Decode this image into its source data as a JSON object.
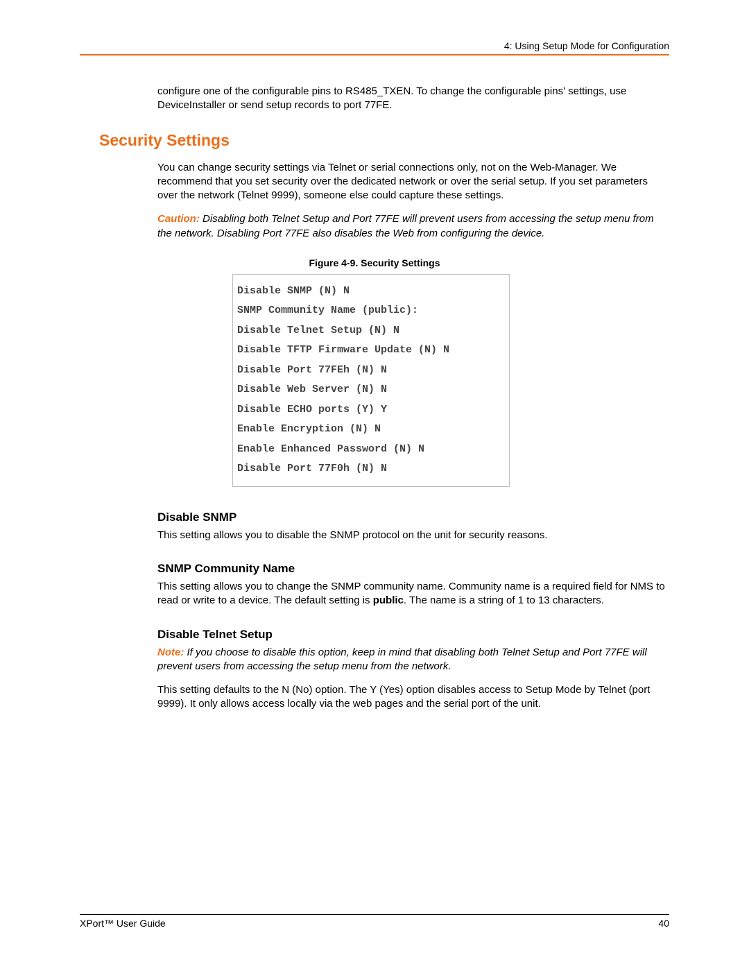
{
  "header": {
    "chapter": "4: Using Setup Mode for Configuration"
  },
  "intro_paragraph": "configure one of the configurable pins to RS485_TXEN.  To change the configurable pins' settings, use DeviceInstaller or send setup records to port 77FE.",
  "section_heading": "Security Settings",
  "security_intro": "You can change security settings via Telnet or serial connections only, not on the Web-Manager. We recommend that you set security over the dedicated network or over the serial setup. If you set parameters over the network (Telnet 9999), someone else could capture these settings.",
  "caution": {
    "label": "Caution:",
    "text": " Disabling both Telnet Setup and Port 77FE will prevent users from accessing the setup menu from the network. Disabling Port 77FE also disables the Web from configuring the device."
  },
  "figure": {
    "caption": "Figure 4-9. Security Settings",
    "lines": [
      "Disable SNMP (N) N",
      "SNMP Community Name (public):",
      "Disable Telnet Setup (N) N",
      "Disable TFTP Firmware Update (N) N",
      "Disable Port 77FEh (N) N",
      "Disable Web Server (N) N",
      "Disable ECHO ports (Y) Y",
      "Enable Encryption (N) N",
      "Enable Enhanced Password (N) N",
      "Disable Port 77F0h (N) N"
    ]
  },
  "sub1": {
    "heading": "Disable SNMP",
    "text": "This setting allows you to disable the SNMP protocol on the unit for security reasons."
  },
  "sub2": {
    "heading": "SNMP Community Name",
    "text_before": "This setting allows you to change the SNMP community name. Community name is a required field for NMS to read or write to a device. The default setting is ",
    "bold": "public",
    "text_after": ". The name is a string of 1 to 13 characters."
  },
  "sub3": {
    "heading": "Disable Telnet Setup",
    "note_label": "Note:",
    "note_text": " If you choose to disable this option, keep in mind that disabling both Telnet Setup and Port 77FE will prevent users from accessing the setup menu from the network.",
    "text": "This setting defaults to the N (No) option. The Y (Yes) option disables access to Setup Mode by Telnet (port 9999). It only allows access locally via the web pages and the serial port of the unit."
  },
  "footer": {
    "left": "XPort™ User Guide",
    "right": "40"
  }
}
